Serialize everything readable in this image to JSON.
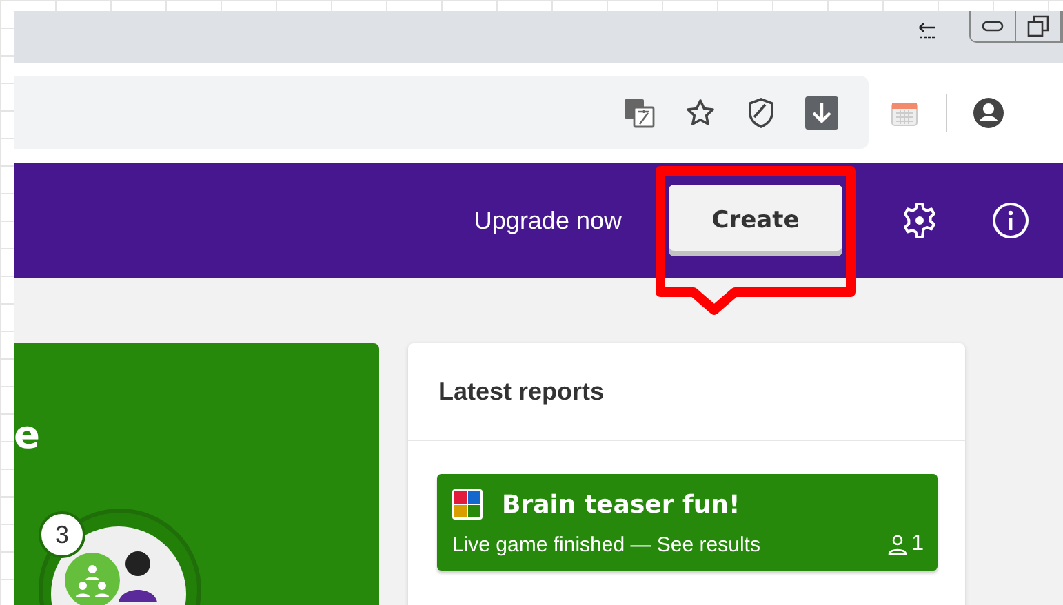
{
  "header": {
    "upgrade_link": "Upgrade now",
    "create_button": "Create"
  },
  "promo_card": {
    "title": "e",
    "badge": "3"
  },
  "latest_reports": {
    "title": "Latest reports",
    "items": [
      {
        "title": "Brain teaser fun!",
        "status": "Live game finished — See results",
        "players": "1"
      }
    ]
  }
}
